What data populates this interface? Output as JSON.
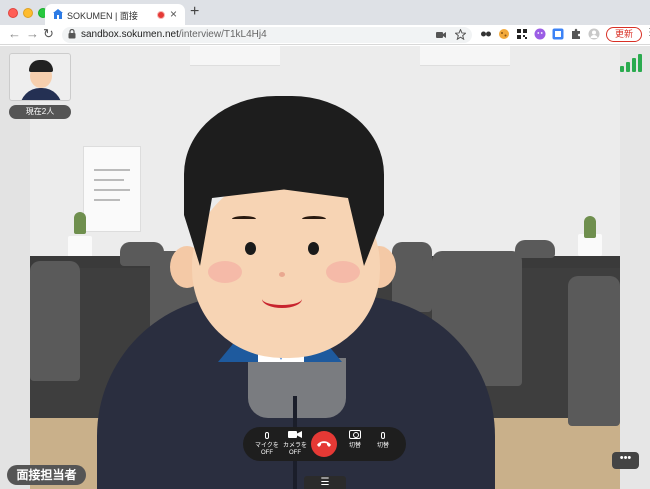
{
  "browser": {
    "tab_title": "SOKUMEN | 面接",
    "tab_close_glyph": "×",
    "new_tab_glyph": "+",
    "url_host": "sandbox.sokumen.net",
    "url_path": "/interview/T1kL4Hj4",
    "update_label": "更新",
    "back_glyph": "←",
    "forward_glyph": "→",
    "reload_glyph": "↻"
  },
  "participants": {
    "count_label": "現在2人"
  },
  "controls": {
    "mic_label": "マイクを\nOFF",
    "camera_label": "カメラを\nOFF",
    "snapshot_label": "切替",
    "audio_switch_label": "切替"
  },
  "interviewer_label": "面接担当者",
  "more_glyph": "•••",
  "bottom_menu_glyph": "☰",
  "colors": {
    "signal": "#2bab4f",
    "hangup": "#e53935",
    "update": "#d93025"
  },
  "icons": [
    "search-icon",
    "lock-icon",
    "star-icon",
    "phone-hangup-icon",
    "microphone-icon",
    "video-camera-icon",
    "camera-icon",
    "signal-icon"
  ]
}
